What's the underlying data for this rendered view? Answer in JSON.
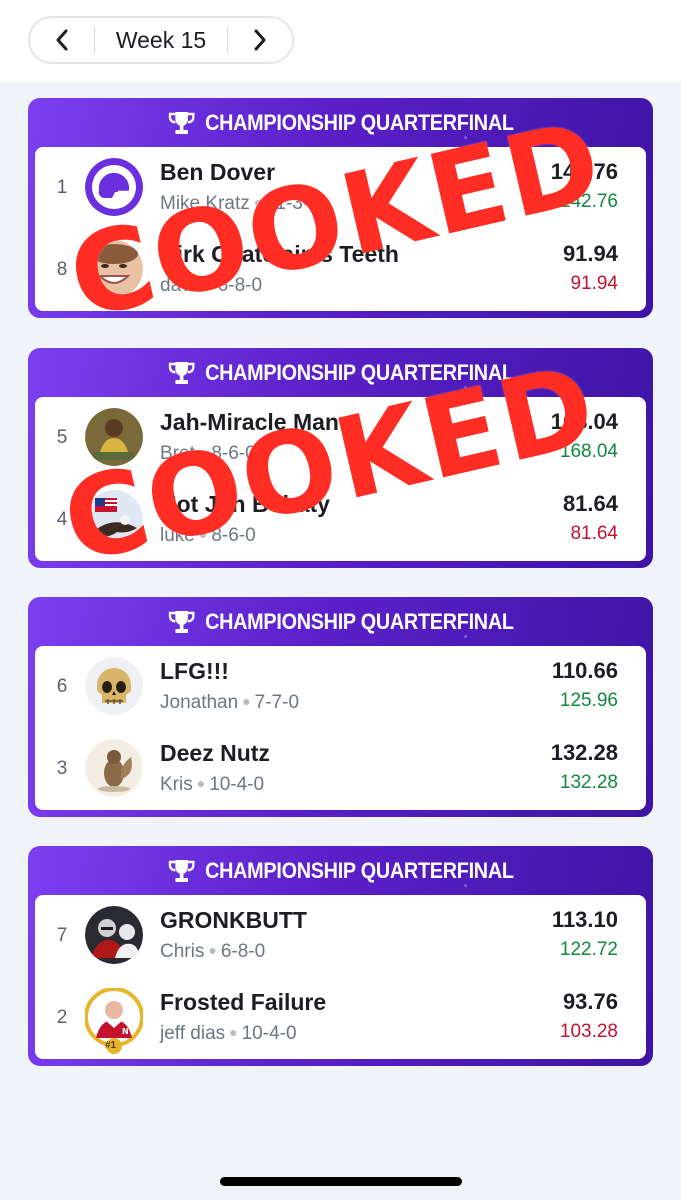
{
  "week_nav": {
    "label": "Week 15"
  },
  "matchups": [
    {
      "header": "CHAMPIONSHIP QUARTERFINAL",
      "teams": [
        {
          "seed": "1",
          "name": "Ben Dover",
          "manager": "Mike Kratz",
          "record": "11-3-0",
          "score": "142.76",
          "projected": "142.76",
          "proj_color": "green",
          "avatar": "helmet-icon"
        },
        {
          "seed": "8",
          "name": "Dirk Chatelain's Teeth",
          "manager": "dave",
          "record": "6-8-0",
          "score": "91.94",
          "projected": "91.94",
          "proj_color": "red",
          "avatar": "smiling-face-photo"
        }
      ]
    },
    {
      "header": "CHAMPIONSHIP QUARTERFINAL",
      "teams": [
        {
          "seed": "5",
          "name": "Jah-Miracle Man",
          "manager": "Bret",
          "record": "8-6-0",
          "score": "168.04",
          "projected": "168.04",
          "proj_color": "green",
          "avatar": "player-photo"
        },
        {
          "seed": "4",
          "name": "Not Jon Bohaty",
          "manager": "luke",
          "record": "8-6-0",
          "score": "81.64",
          "projected": "81.64",
          "proj_color": "red",
          "avatar": "eagle-flag-photo"
        }
      ]
    },
    {
      "header": "CHAMPIONSHIP QUARTERFINAL",
      "teams": [
        {
          "seed": "6",
          "name": "LFG!!!",
          "manager": "Jonathan",
          "record": "7-7-0",
          "score": "110.66",
          "projected": "125.96",
          "proj_color": "green",
          "avatar": "skull-icon"
        },
        {
          "seed": "3",
          "name": "Deez Nutz",
          "manager": "Kris",
          "record": "10-4-0",
          "score": "132.28",
          "projected": "132.28",
          "proj_color": "green",
          "avatar": "squirrel-photo"
        }
      ]
    },
    {
      "header": "CHAMPIONSHIP QUARTERFINAL",
      "teams": [
        {
          "seed": "7",
          "name": "GRONKBUTT",
          "manager": "Chris",
          "record": "6-8-0",
          "score": "113.10",
          "projected": "122.72",
          "proj_color": "green",
          "avatar": "football-players-photo"
        },
        {
          "seed": "2",
          "name": "Frosted Failure",
          "manager": "jeff dias",
          "record": "10-4-0",
          "score": "93.76",
          "projected": "103.28",
          "proj_color": "red",
          "avatar": "coach-photo",
          "badge": "#1"
        }
      ]
    }
  ],
  "overlays": [
    "COOKED",
    "COOKED"
  ],
  "colors": {
    "purple_start": "#7b3ff0",
    "purple_end": "#3e14a4",
    "green": "#12883f",
    "red": "#c4122f",
    "cooked": "#ff2d24"
  }
}
